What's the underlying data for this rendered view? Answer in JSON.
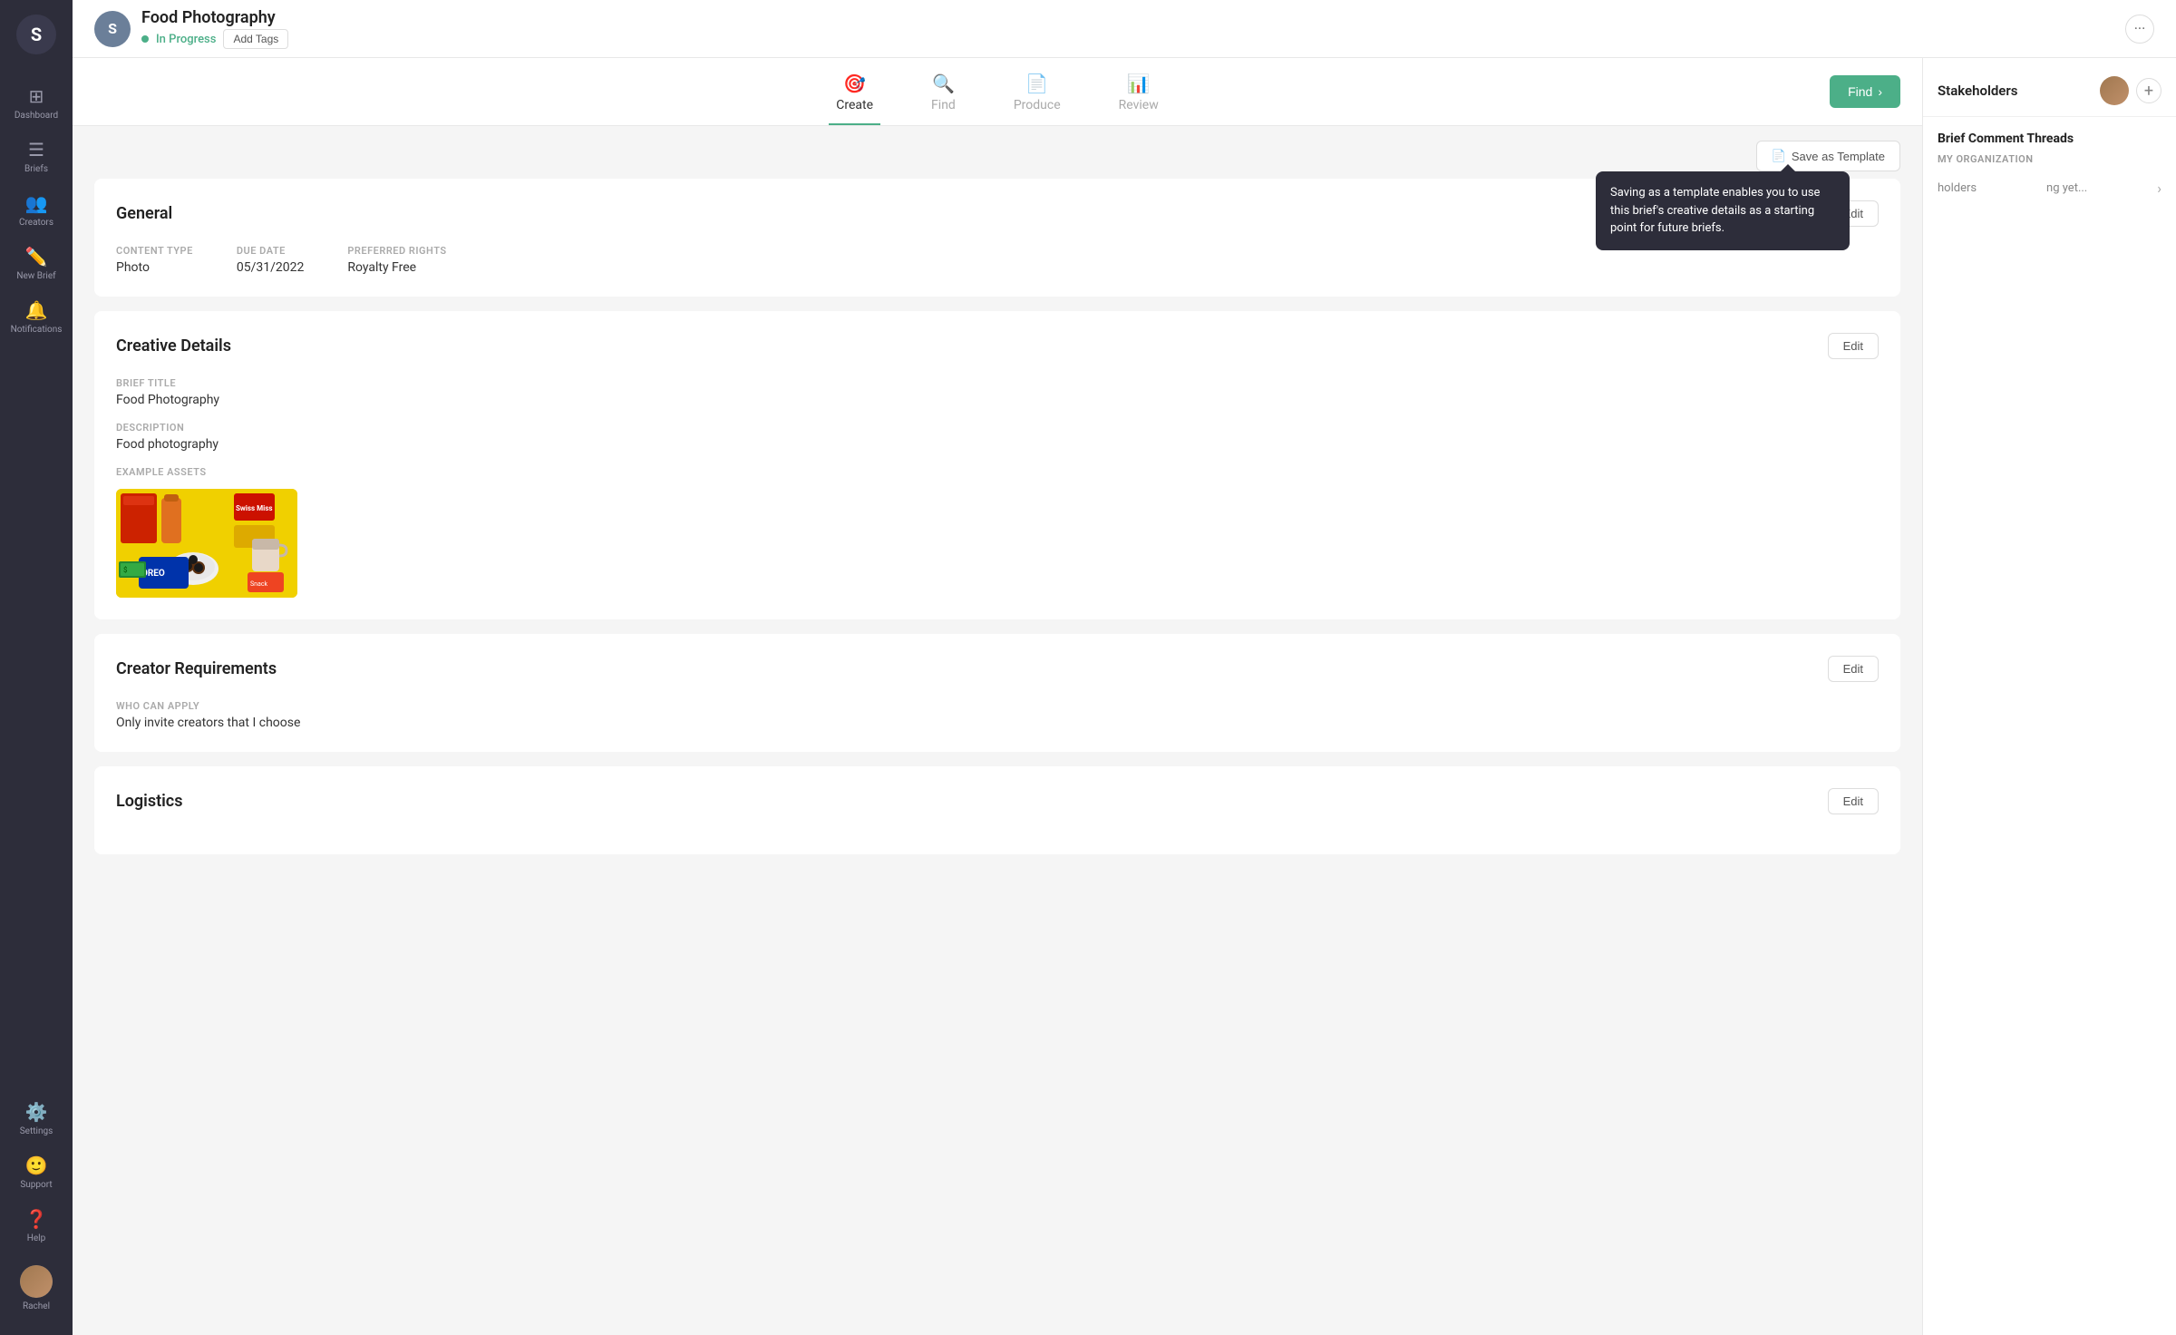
{
  "sidebar": {
    "logo_letter": "S",
    "items": [
      {
        "id": "dashboard",
        "label": "Dashboard",
        "icon": "⊞"
      },
      {
        "id": "briefs",
        "label": "Briefs",
        "icon": "📋"
      },
      {
        "id": "creators",
        "label": "Creators",
        "icon": "👥"
      },
      {
        "id": "new-brief",
        "label": "New Brief",
        "icon": "✏️"
      },
      {
        "id": "notifications",
        "label": "Notifications",
        "icon": "🔔"
      }
    ],
    "bottom_items": [
      {
        "id": "settings",
        "label": "Settings",
        "icon": "⚙️"
      },
      {
        "id": "support",
        "label": "Support",
        "icon": "👤"
      },
      {
        "id": "help",
        "label": "Help",
        "icon": "❓"
      }
    ],
    "user_name": "Rachel"
  },
  "header": {
    "avatar_letter": "S",
    "title": "Food Photography",
    "status": "In Progress",
    "add_tags_label": "Add Tags",
    "more_icon": "···"
  },
  "right_panel": {
    "title": "Stakeholders",
    "add_button": "+",
    "comment_threads_title": "Brief Comment Threads",
    "org_label": "MY ORGANIZATION",
    "stakeholders_text": "holders",
    "no_comments_text": "ng yet..."
  },
  "tabs": [
    {
      "id": "create",
      "label": "Create",
      "icon": "🎯",
      "active": true
    },
    {
      "id": "find",
      "label": "Find",
      "icon": "🔍",
      "active": false
    },
    {
      "id": "produce",
      "label": "Produce",
      "icon": "📄",
      "active": false
    },
    {
      "id": "review",
      "label": "Review",
      "icon": "📊",
      "active": false
    }
  ],
  "find_button_label": "Find",
  "toolbar": {
    "save_template_label": "Save as Template",
    "save_icon": "📄"
  },
  "tooltip": {
    "text": "Saving as a template enables you to use this brief's creative details as a starting point for future briefs."
  },
  "sections": {
    "general": {
      "title": "General",
      "edit_label": "Edit",
      "content_type_label": "CONTENT TYPE",
      "content_type_value": "Photo",
      "due_date_label": "DUE DATE",
      "due_date_value": "05/31/2022",
      "preferred_rights_label": "PREFERRED RIGHTS",
      "preferred_rights_value": "Royalty Free"
    },
    "creative_details": {
      "title": "Creative Details",
      "edit_label": "Edit",
      "brief_title_label": "BRIEF TITLE",
      "brief_title_value": "Food Photography",
      "description_label": "DESCRIPTION",
      "description_value": "Food photography",
      "example_assets_label": "EXAMPLE ASSETS"
    },
    "creator_requirements": {
      "title": "Creator Requirements",
      "edit_label": "Edit",
      "who_can_apply_label": "WHO CAN APPLY",
      "who_can_apply_value": "Only invite creators that I choose"
    },
    "logistics": {
      "title": "Logistics",
      "edit_label": "Edit"
    }
  }
}
